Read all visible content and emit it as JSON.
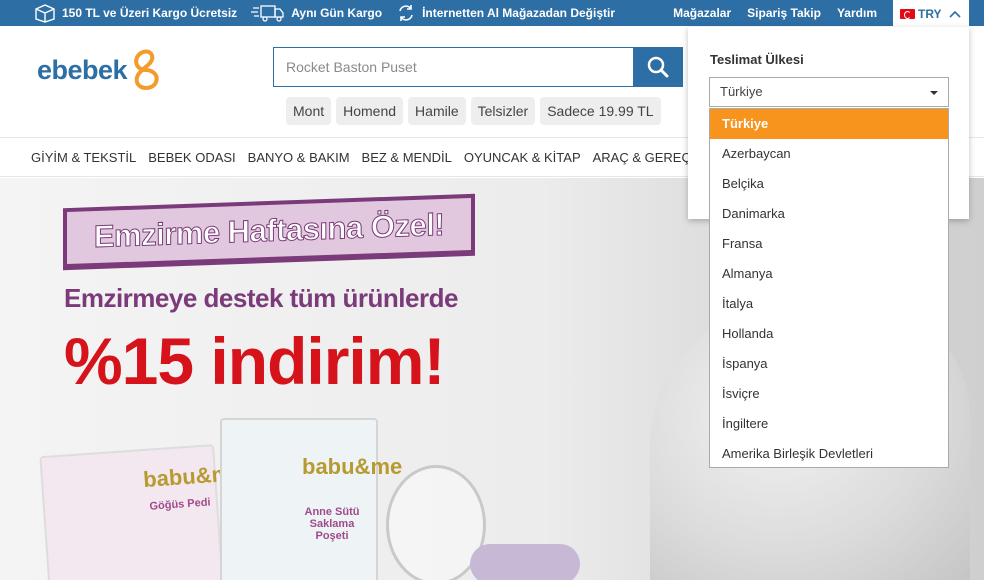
{
  "topbar": {
    "promos": [
      {
        "icon": "box-icon",
        "text": "150 TL ve Üzeri Kargo Ücretsiz"
      },
      {
        "icon": "truck-icon",
        "text": "Aynı Gün Kargo"
      },
      {
        "icon": "exchange-icon",
        "text": "İnternetten Al Mağazadan Değiştir"
      }
    ],
    "links": [
      "Mağazalar",
      "Sipariş Takip",
      "Yardım"
    ],
    "currency": "TRY"
  },
  "header": {
    "logo": "ebebek",
    "search_placeholder": "Rocket Baston Puset",
    "tags": [
      "Mont",
      "Homend",
      "Hamile",
      "Telsizler",
      "Sadece 19.99 TL"
    ]
  },
  "categories": [
    "GİYİM & TEKSTİL",
    "BEBEK ODASI",
    "BANYO & BAKIM",
    "BEZ & MENDİL",
    "OYUNCAK & KİTAP",
    "ARAÇ & GEREÇ"
  ],
  "banner": {
    "ribbon": "Emzirme Haftasına Özel!",
    "subtitle": "Emzirmeye destek tüm ürünlerde",
    "headline": "%15 indirim!",
    "product1_brand": "babu&me",
    "product1_label": "Göğüs Pedi",
    "product2_brand": "babu&me",
    "product2_label": "Anne Sütü Saklama Poşeti"
  },
  "delivery_panel": {
    "title": "Teslimat Ülkesi",
    "selected": "Türkiye",
    "options": [
      "Türkiye",
      "Azerbaycan",
      "Belçika",
      "Danimarka",
      "Fransa",
      "Almanya",
      "İtalya",
      "Hollanda",
      "İspanya",
      "İsviçre",
      "İngiltere",
      "Amerika Birleşik Devletleri"
    ]
  },
  "colors": {
    "brand_blue": "#2d6ea5",
    "highlight_orange": "#f7941d",
    "logo_orange": "#f39c2b",
    "promo_purple": "#7b3b7a",
    "promo_red": "#d6131b"
  }
}
